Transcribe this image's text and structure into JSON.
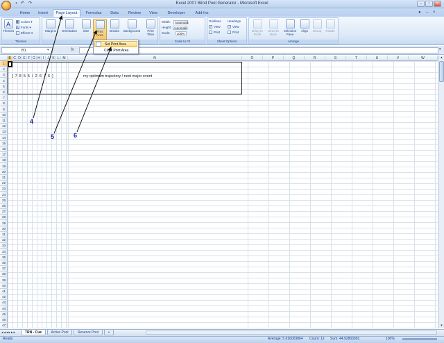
{
  "window": {
    "title": "Excel 2007 Blind Pool Generator - Microsoft Excel",
    "qat_icons": [
      "save-icon",
      "undo-icon",
      "redo-icon"
    ]
  },
  "tabs": [
    "Home",
    "Insert",
    "Page Layout",
    "Formulas",
    "Data",
    "Review",
    "View",
    "Developer",
    "Add-Ins"
  ],
  "active_tab": "Page Layout",
  "ribbon": {
    "themes": {
      "label": "Themes",
      "themes_btn": "Themes",
      "colors": "Colors",
      "fonts": "Fonts",
      "effects": "Effects"
    },
    "page_setup": {
      "label": "Page Setup",
      "margins": "Margins",
      "orientation": "Orientation",
      "size": "Size",
      "print_area": "Print Area",
      "breaks": "Breaks",
      "background": "Background",
      "print_titles": "Print Titles"
    },
    "scale_to_fit": {
      "label": "Scale to Fit",
      "width_label": "Width:",
      "width_value": "Automatic",
      "height_label": "Height:",
      "height_value": "Automatic",
      "scale_label": "Scale:",
      "scale_value": "100%"
    },
    "sheet_options": {
      "label": "Sheet Options",
      "gridlines": "Gridlines",
      "headings": "Headings",
      "view": "View",
      "print": "Print"
    },
    "arrange": {
      "label": "Arrange",
      "bring_to_front": "Bring to Front",
      "send_to_back": "Send to Back",
      "selection_pane": "Selection Pane",
      "align": "Align",
      "group": "Group",
      "rotate": "Rotate"
    }
  },
  "print_area_menu": [
    "Set Print Area",
    "Clear Print Area"
  ],
  "formula_bar": {
    "name_box": "B1",
    "fx": "fx",
    "value": ""
  },
  "columns": [
    "B",
    "C",
    "D",
    "E",
    "F",
    "G",
    "H",
    "I",
    "J",
    "K",
    "L",
    "M",
    "N",
    "O",
    "P",
    "Q",
    "R",
    "S",
    "T",
    "U",
    "V",
    "W"
  ],
  "rows": [
    "1",
    "2",
    "3",
    "4",
    "5",
    "6",
    "7",
    "8",
    "9",
    "10",
    "11",
    "12",
    "13",
    "14",
    "15",
    "16",
    "17",
    "18",
    "19",
    "20",
    "21",
    "22",
    "23",
    "24",
    "25",
    "26",
    "27",
    "28",
    "29",
    "30",
    "31",
    "32",
    "33",
    "34",
    "35",
    "36",
    "37",
    "38",
    "39",
    "40",
    "41",
    "42",
    "43",
    "44",
    "45",
    "46",
    "47"
  ],
  "cells": {
    "row3_sequence": "[  7  8  5  5  /  2  6  7  6  ]",
    "row3_note": "my optimum trajectory / next major event"
  },
  "sheets": [
    "TRN - Cue",
    "Active Pool",
    "Reserve Pool"
  ],
  "active_sheet": "TRN - Cue",
  "status": {
    "ready": "Ready",
    "average": "Average: 5.616003864",
    "count": "Count: 12",
    "sum": "Sum: 44.92803091",
    "zoom": "100%"
  },
  "callouts": [
    "4",
    "5",
    "6"
  ],
  "colors": {
    "ribbon_blue": "#15428b",
    "selection_orange": "#f7c26a",
    "callout_blue": "#1a1aa8"
  }
}
